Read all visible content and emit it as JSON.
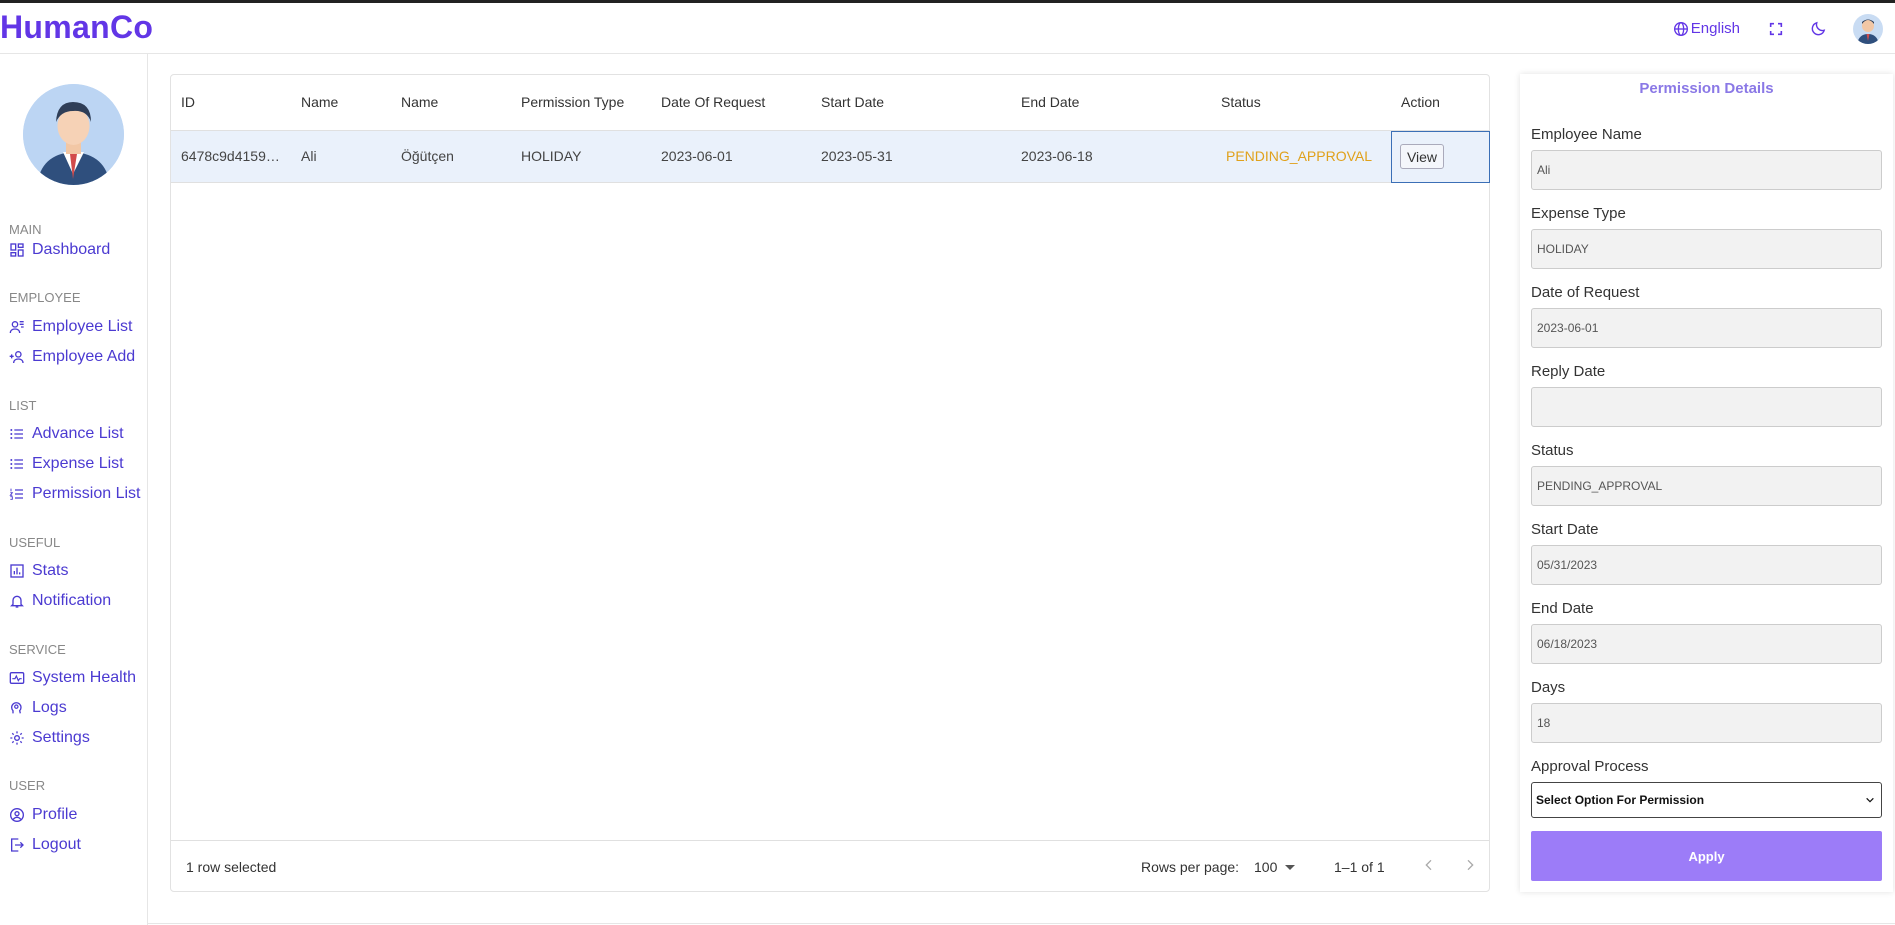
{
  "app": {
    "brand": "HumanCo"
  },
  "header": {
    "language": "English"
  },
  "sidebar": {
    "sections": [
      {
        "heading": "MAIN",
        "items": [
          {
            "label": "Dashboard",
            "icon": "dashboard-icon"
          }
        ]
      },
      {
        "heading": "EMPLOYEE",
        "items": [
          {
            "label": "Employee List",
            "icon": "people-icon"
          },
          {
            "label": "Employee Add",
            "icon": "person-add-icon"
          }
        ]
      },
      {
        "heading": "LIST",
        "items": [
          {
            "label": "Advance List",
            "icon": "list-icon"
          },
          {
            "label": "Expense List",
            "icon": "list-icon"
          },
          {
            "label": "Permission List",
            "icon": "list-numbered-icon"
          }
        ]
      },
      {
        "heading": "USEFUL",
        "items": [
          {
            "label": "Stats",
            "icon": "chart-icon"
          },
          {
            "label": "Notification",
            "icon": "bell-icon"
          }
        ]
      },
      {
        "heading": "SERVICE",
        "items": [
          {
            "label": "System Health",
            "icon": "health-icon"
          },
          {
            "label": "Logs",
            "icon": "psychology-icon"
          },
          {
            "label": "Settings",
            "icon": "gear-icon"
          }
        ]
      },
      {
        "heading": "USER",
        "items": [
          {
            "label": "Profile",
            "icon": "account-icon"
          },
          {
            "label": "Logout",
            "icon": "logout-icon"
          }
        ]
      }
    ]
  },
  "table": {
    "columns": [
      "ID",
      "Name",
      "Name",
      "Permission Type",
      "Date Of Request",
      "Start Date",
      "End Date",
      "Status",
      "Action"
    ],
    "rows": [
      {
        "id": "6478c9d4159…",
        "first_name": "Ali",
        "last_name": "Öğütçen",
        "permission_type": "HOLIDAY",
        "date_of_request": "2023-06-01",
        "start_date": "2023-05-31",
        "end_date": "2023-06-18",
        "status": "PENDING_APPROVAL",
        "action": "View"
      }
    ],
    "footer": {
      "selected": "1 row selected",
      "rows_per_page_label": "Rows per page:",
      "rows_per_page": "100",
      "range": "1–1 of 1"
    }
  },
  "details": {
    "title": "Permission Details",
    "fields": [
      {
        "label": "Employee Name",
        "value": "Ali"
      },
      {
        "label": "Expense Type",
        "value": "HOLIDAY"
      },
      {
        "label": "Date of Request",
        "value": "2023-06-01"
      },
      {
        "label": "Reply Date",
        "value": ""
      },
      {
        "label": "Status",
        "value": "PENDING_APPROVAL"
      },
      {
        "label": "Start Date",
        "value": "05/31/2023"
      },
      {
        "label": "End Date",
        "value": "06/18/2023"
      },
      {
        "label": "Days",
        "value": "18"
      }
    ],
    "approval_label": "Approval Process",
    "approval_select": "Select Option For Permission",
    "apply_label": "Apply"
  },
  "colors": {
    "brand": "#6236e6",
    "nav": "#4b3ad1",
    "status_pending": "#e0a11b",
    "apply": "#9c7cf8",
    "selected_row": "#eaf1fb"
  }
}
